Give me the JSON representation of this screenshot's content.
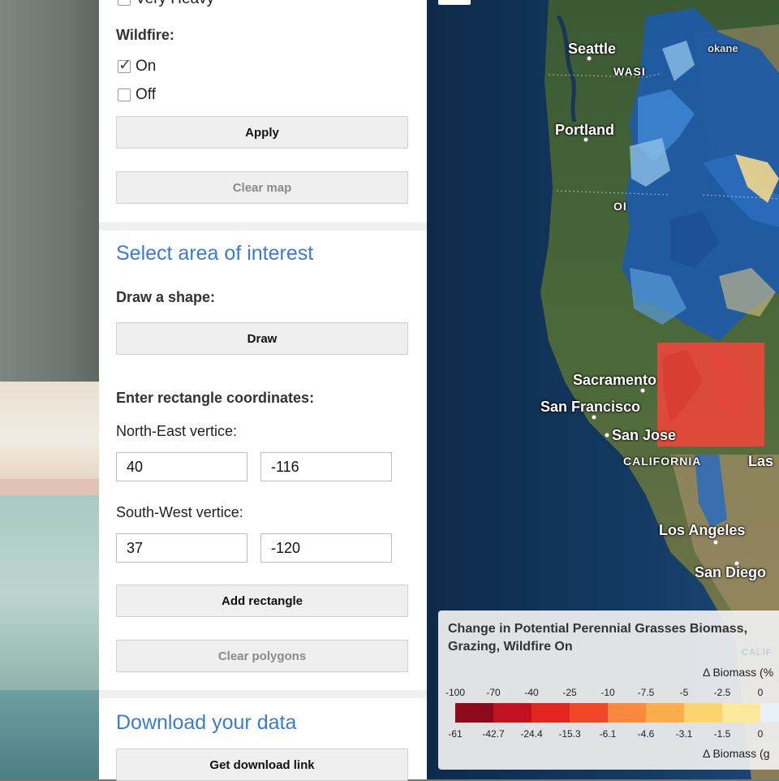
{
  "panel": {
    "top_option": "Very Heavy",
    "wildfire": {
      "label": "Wildfire:",
      "options": [
        {
          "label": "On",
          "checked": true
        },
        {
          "label": "Off",
          "checked": false
        }
      ]
    },
    "apply_button": "Apply",
    "clear_map_button": "Clear map",
    "aoi_section": {
      "heading": "Select area of interest",
      "draw_label": "Draw a shape:",
      "draw_button": "Draw",
      "coords_label": "Enter rectangle coordinates:",
      "ne_label": "North-East vertice:",
      "ne_lat": "40",
      "ne_lon": "-116",
      "sw_label": "South-West vertice:",
      "sw_lat": "37",
      "sw_lon": "-120",
      "add_rectangle_button": "Add rectangle",
      "clear_polygons_button": "Clear polygons"
    },
    "download_section": {
      "heading": "Download your data",
      "get_link_button": "Get download link"
    }
  },
  "map": {
    "place_labels": {
      "seattle": "Seattle",
      "spokane": "okane",
      "wash": "WASI",
      "portland": "Portland",
      "oregon": "OI",
      "sacramento": "Sacramento",
      "san_francisco": "San Francisco",
      "san_jose": "San Jose",
      "california": "CALIFORNIA",
      "las_vegas": "Las",
      "los_angeles": "Los Angeles",
      "san_diego": "San Diego",
      "cali_faint": "CALIF"
    },
    "selection_color": "#f0453a"
  },
  "legend": {
    "title": "Change in Potential Perennial Grasses Biomass, Grazing, Wildfire On",
    "unit_top": "Δ Biomass (%",
    "unit_bottom": "Δ Biomass (g",
    "top_ticks": [
      "-100",
      "-70",
      "-40",
      "-25",
      "-10",
      "-7.5",
      "-5",
      "-2.5",
      "0"
    ],
    "bottom_ticks": [
      "-61",
      "-42.7",
      "-24.4",
      "-15.3",
      "-6.1",
      "-4.6",
      "-3.1",
      "-1.5",
      "0"
    ],
    "colors": [
      "#8c0a1c",
      "#c1121f",
      "#e32620",
      "#f2482a",
      "#fb8a3c",
      "#fdae4b",
      "#fed46e",
      "#fee89a",
      "#e8f1f7"
    ]
  }
}
